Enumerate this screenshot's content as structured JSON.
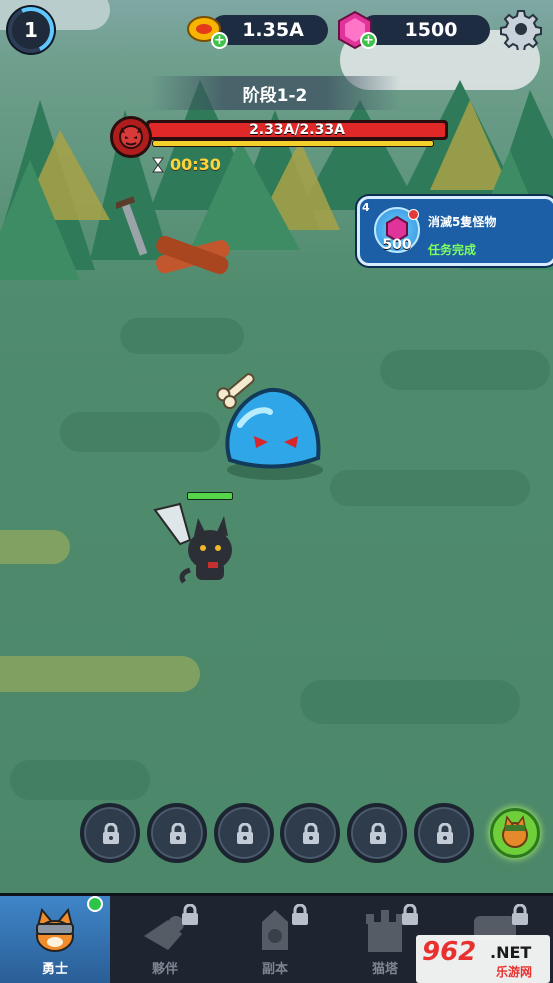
{
  "hud": {
    "player_level": "1",
    "gold": "1.35A",
    "gems": "1500"
  },
  "stage": {
    "name": "阶段1-2",
    "boss_hp_text": "2.33A/2.33A",
    "boss_hp_fraction": 1.0,
    "timer": "00:30"
  },
  "quest": {
    "number": "4",
    "reward_amount": "500",
    "title": "消滅5隻怪物",
    "status": "任务完成"
  },
  "skill_slots": {
    "locked_count": 6,
    "icon": "lock-icon"
  },
  "nav": {
    "items": [
      {
        "label": "勇士",
        "icon": "cat-warrior-icon",
        "locked": false,
        "active": true
      },
      {
        "label": "夥伴",
        "icon": "companion-icon",
        "locked": true,
        "active": false
      },
      {
        "label": "副本",
        "icon": "dungeon-icon",
        "locked": true,
        "active": false
      },
      {
        "label": "猫塔",
        "icon": "tower-icon",
        "locked": true,
        "active": false
      },
      {
        "label": "",
        "icon": "chest-icon",
        "locked": true,
        "active": false
      }
    ]
  },
  "watermark": {
    "main": "962",
    "net": ".NET",
    "sub": "乐游网"
  },
  "colors": {
    "boss_hp": "#e02828",
    "timer": "#ffd43b",
    "quest_done": "#7cff5f",
    "nav_active": "#3f86c9"
  }
}
